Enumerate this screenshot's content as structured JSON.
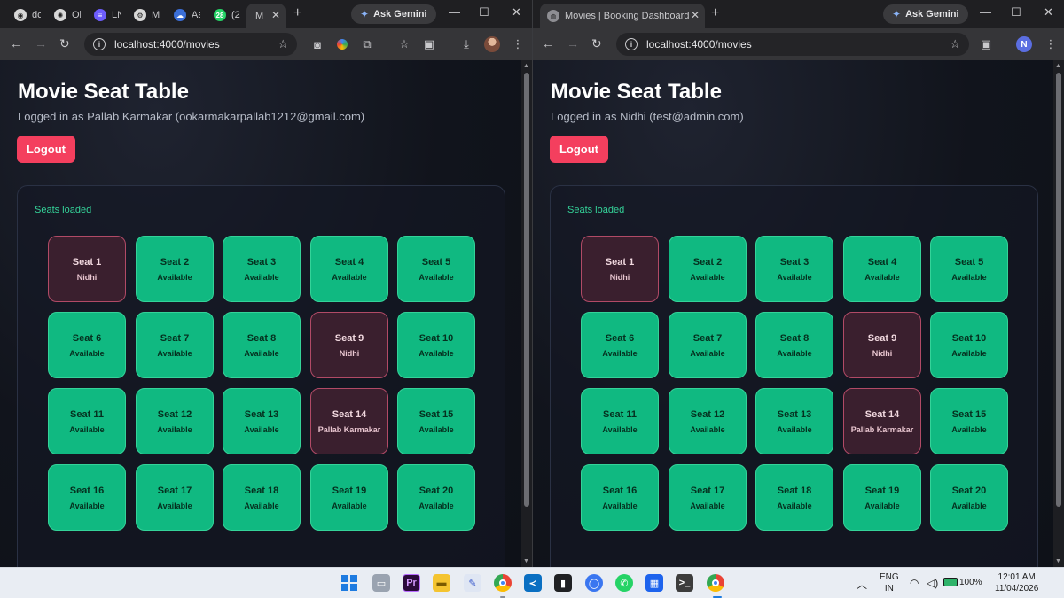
{
  "left_window": {
    "tabs": [
      {
        "title": "dc",
        "icon": "github-icon"
      },
      {
        "title": "Ol",
        "icon": "openai-icon"
      },
      {
        "title": "LN",
        "icon": "linear-icon"
      },
      {
        "title": "M",
        "icon": "app-icon"
      },
      {
        "title": "As",
        "icon": "cloud-icon"
      },
      {
        "title": "(2",
        "icon": "whatsapp-icon",
        "badge": "28"
      },
      {
        "title": "M",
        "icon": "page-icon",
        "active": true
      }
    ],
    "gemini_label": "Ask Gemini",
    "url": "localhost:4000/movies",
    "page": {
      "title": "Movie Seat Table",
      "logged_in": "Logged in as Pallab Karmakar (ookarmakarpallab1212@gmail.com)",
      "logout_label": "Logout",
      "status": "Seats loaded"
    }
  },
  "right_window": {
    "tabs": [
      {
        "title": "Movies | Booking Dashboard",
        "icon": "globe-icon",
        "active": true
      }
    ],
    "gemini_label": "Ask Gemini",
    "url": "localhost:4000/movies",
    "profile_initial": "N",
    "page": {
      "title": "Movie Seat Table",
      "logged_in": "Logged in as Nidhi (test@admin.com)",
      "logout_label": "Logout",
      "status": "Seats loaded"
    }
  },
  "seats": [
    {
      "name": "Seat 1",
      "status": "Nidhi",
      "booked": true
    },
    {
      "name": "Seat 2",
      "status": "Available",
      "booked": false
    },
    {
      "name": "Seat 3",
      "status": "Available",
      "booked": false
    },
    {
      "name": "Seat 4",
      "status": "Available",
      "booked": false
    },
    {
      "name": "Seat 5",
      "status": "Available",
      "booked": false
    },
    {
      "name": "Seat 6",
      "status": "Available",
      "booked": false
    },
    {
      "name": "Seat 7",
      "status": "Available",
      "booked": false
    },
    {
      "name": "Seat 8",
      "status": "Available",
      "booked": false
    },
    {
      "name": "Seat 9",
      "status": "Nidhi",
      "booked": true
    },
    {
      "name": "Seat 10",
      "status": "Available",
      "booked": false
    },
    {
      "name": "Seat 11",
      "status": "Available",
      "booked": false
    },
    {
      "name": "Seat 12",
      "status": "Available",
      "booked": false
    },
    {
      "name": "Seat 13",
      "status": "Available",
      "booked": false
    },
    {
      "name": "Seat 14",
      "status": "Pallab Karmakar",
      "booked": true
    },
    {
      "name": "Seat 15",
      "status": "Available",
      "booked": false
    },
    {
      "name": "Seat 16",
      "status": "Available",
      "booked": false
    },
    {
      "name": "Seat 17",
      "status": "Available",
      "booked": false
    },
    {
      "name": "Seat 18",
      "status": "Available",
      "booked": false
    },
    {
      "name": "Seat 19",
      "status": "Available",
      "booked": false
    },
    {
      "name": "Seat 20",
      "status": "Available",
      "booked": false
    }
  ],
  "colors": {
    "available": "#10b981",
    "booked": "#3a1f2e",
    "logout": "#f43f5e",
    "status_text": "#34d399"
  },
  "taskbar": {
    "apps": [
      "windows-start-icon",
      "file-explorer-icon",
      "premiere-icon",
      "folder-icon",
      "notepad-icon",
      "chrome-icon",
      "vscode-icon",
      "terminal-icon",
      "signal-icon",
      "whatsapp-icon",
      "docker-icon",
      "console-icon",
      "chrome-profile-icon"
    ],
    "lang": "ENG",
    "region": "IN",
    "battery": "100%",
    "time": "12:01 AM",
    "date": "11/04/2026"
  }
}
